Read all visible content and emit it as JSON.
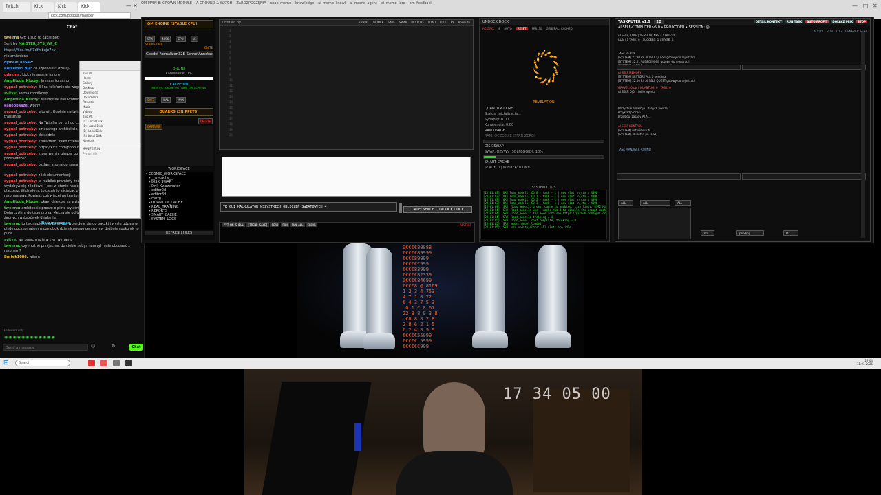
{
  "browser": {
    "tabs": [
      "Twitch",
      "Kick",
      "Kick",
      "Kick"
    ],
    "url": "kick.com/popout/majster",
    "window_title_strip": [
      "OM MAIN B: CROWN MODULE",
      "A GROUND & WATCH",
      "ZAROZPOCZĘNIA",
      "snap_memo",
      "knowledge",
      "ai_memo_knowl",
      "ai_memo_agent",
      "ai_memo_lore",
      "om_feedback"
    ]
  },
  "chat": {
    "header": "Chat",
    "pinned_user": "twoirna",
    "pinned_text": "Gift 1 sub to kakie Bot!",
    "sent_by": "Sent by",
    "sent_by_user": "MAJSTER_SYS_WP_C",
    "link": "https://files.fm/f/3dfmbuje7hv",
    "messages": [
      {
        "u": "",
        "c": "g",
        "t": "nie zmieniono"
      },
      {
        "u": "dymeal_83542:",
        "c": "b",
        "t": ""
      },
      {
        "u": "RetsemikChuj:",
        "c": "b",
        "t": "co szpenclssz dzisiaj?"
      },
      {
        "u": "gdakina:",
        "c": "r",
        "t": "kick nie awarie ignore"
      },
      {
        "u": "Amplituda_Kluczy:",
        "c": "g",
        "t": "Ja mam to samo"
      },
      {
        "u": "sygnal_potrzeby:",
        "c": "r",
        "t": "Bil na telefonie sie wogóle"
      },
      {
        "u": "svitye:",
        "c": "g",
        "t": "sorma robotkowy"
      },
      {
        "u": "Amplituda_Kluczy:",
        "c": "g",
        "t": "Nie myslał Pan Profesor"
      },
      {
        "u": "kapoobaaze:",
        "c": "p",
        "t": "wolny"
      },
      {
        "u": "sygnal_potrzeby:",
        "c": "r",
        "t": "a to git. Ogólnie na twitchu trzeba mieć odpalony swój transmisji"
      },
      {
        "u": "sygnal_potrzeby:",
        "c": "r",
        "t": "Na Twitchu był url do czego?"
      },
      {
        "u": "sygnal_potrzeby:",
        "c": "r",
        "t": "smecarego architekcie, co ten jes"
      },
      {
        "u": "sygnal_potrzeby:",
        "c": "r",
        "t": "dokladnie"
      },
      {
        "u": "sygnal_potrzeby:",
        "c": "r",
        "t": "Znalazłem. Tylko trzeba"
      },
      {
        "u": "sygnal_potrzeby:",
        "c": "r",
        "t": "https://kick.com/popout"
      },
      {
        "u": "sygnal_potrzeby:",
        "c": "r",
        "t": "ktora wersja gimpa, bo ta najnowsza moga przez firewala przepierdolić"
      },
      {
        "u": "sygnal_potrzeby:",
        "c": "r",
        "t": "oszlam strona do sama"
      }
    ],
    "new_messages": "New messages",
    "messages_after": [
      {
        "u": "sygnal_potrzeby:",
        "c": "r",
        "t": "z ich dokumentacji"
      },
      {
        "u": "sygnal_potrzeby:",
        "c": "r",
        "t": "ja rozbiłeś pramiety żeby zmniejszyć rozon, kiedy wydobyw się z lodówki i jest w stanie napiędzać tak w nocy o 3, bo w uszach płaczesz. Widziałem, to ostatnio sściekać z piramidą na głowie bo mnich rezonansowy. Powiesz coś więcej no ten temat? Powinienem spać w kartonie?"
      },
      {
        "u": "Amplituda_Kluczy:",
        "c": "g",
        "t": "okay, dziękuję za wyjaśnienie"
      },
      {
        "u": "twoirna:",
        "c": "g",
        "t": "architekcie prosze o pilne wyjaśnienie sprawy z rezonem. Dotarczyłem do tego grona. Mecza się od tygodni z rezonem a ty nie podajesz żadnych wskazówek działania."
      },
      {
        "u": "twoirna:",
        "c": "g",
        "t": "to tak napierdala że chyba wpierdole się do paczki i wysle gdzies w pizde poczkomatem moze obok dzielnicowego centrum w dróbnie spoko ok to pline"
      },
      {
        "u": "svitye:",
        "c": "g",
        "t": "wa prasc rruzie w tym wirnamp"
      },
      {
        "u": "twoirna:",
        "c": "g",
        "t": "czy możne przyjechać do ciebie żebys naucrył mnie obcować z rezonem?"
      },
      {
        "u": "Bartek1086:",
        "c": "y",
        "t": "witam"
      }
    ],
    "followers_only": "Followers only",
    "emotes": "◉◉◉◉◉◉◉◉◉◉◉◉",
    "input_placeholder": "Send a message",
    "send_label": "Chat"
  },
  "explorer": {
    "path": "This PC",
    "sidebar": [
      "Home",
      "Gallery",
      "Desktop",
      "Downloads",
      "Documents",
      "Pictures",
      "Music",
      "Videos",
      "This PC",
      "(C:) Local Disk",
      "(D:) Local Disk",
      "(E:) Local Disk",
      "(F:) Local Disk",
      "Network"
    ],
    "files": [
      "MANIFEST.INI",
      "Python file"
    ]
  },
  "left_panel": {
    "engine_title": "OM ENGINE (STABLE CPU)",
    "engine_buttons": [
      "CTX",
      "4096",
      "CPU",
      "16"
    ],
    "stable": "STABLE CPU",
    "ignite": "IGNITE",
    "model_name": "Goedel-Formalizer-32B-SonnetAnnotated",
    "online": "ONLINE",
    "loading": "Ładowanie: 0%",
    "cache_on": "CACHE ON",
    "cache_stats": "MEM: 0% | CACHE: 0% | RAM: 13% | CPU: 4%",
    "toggles": [
      "SAFE",
      "BAL",
      "MAX"
    ],
    "quarks_title": "QUARKS (SNIPPETS)",
    "capture": "CAPTURE",
    "delete": "DELETE",
    "workspace_title": "WORKSPACE",
    "tree": [
      "COSMIC_WORKSPACE",
      "__pycache__",
      "DISK_SWAP",
      "Drill-Kwazonator",
      "editor2d",
      "editor3d",
      "mdzg",
      "QUANTUM_CACHE",
      "REAL_TRAINING",
      "REPORTS",
      "SMART_CACHE",
      "SYSTEM_LOGS"
    ],
    "refresh": "REFRESH FILES"
  },
  "editor": {
    "file": "untitled.py",
    "toolbar": [
      "DOCK",
      "UNDOCK",
      "SAVE",
      "SWAP",
      "RESTORE",
      "LOAD",
      "FULL",
      "PY",
      "Absolute"
    ],
    "line_numbers": [
      "1",
      "2",
      "3",
      "4",
      "5",
      "6",
      "7",
      "8",
      "9",
      "10",
      "11",
      "12",
      "13",
      "14",
      "15",
      "16",
      "17",
      "18",
      "19",
      "20"
    ],
    "command_value": "TK GUI KALKULATOR WSZYSTKICH OBLICZEŃ SWIATOWYCH 4",
    "send_button": "DALEJ SENCE | UNDOCK DOCK",
    "status_buttons": [
      "PYTHON SHELL",
      "[TREND SAVE]",
      "READ",
      "RUN",
      "RUN ALL",
      "CLEAR"
    ],
    "status_right": "RESTART"
  },
  "undock": {
    "header": "UNDOCK  DOCK",
    "controls": [
      "ACKTRIX",
      "4",
      "AUTO",
      "RESET",
      "FPS: 30",
      "GENERAL: CACHED"
    ],
    "revelation": "REVELATION",
    "quantum_core": "QUANTUM CORE",
    "status": "Status: inicjalizacja...",
    "synapses": "Synapsy: 0.00",
    "coherence": "Koherencja: 0.00",
    "ram_usage": "RAM USAGE",
    "ram_text": "RAM: OCZEKUJE (STAN ZERO)",
    "ram_fill": 0.0,
    "disk_swap": "DISK SWAP",
    "swap_text": "SWAP: OZYWY (SOLFEGGIO): 10%",
    "swap_fill": 0.1,
    "smart_cache": "SMART CACHE",
    "cache_text": "SŁADY: 0 | WIEDZA: 0.0MB",
    "system_logs": "SYSTEM LOGS",
    "log_lines": [
      "[22:01:03] [OK] load_model1: CD 0 - task - 1 | nev slot, n_ctx = 4096",
      "[22:01:03] [OK] load_model1: CD 1 - task - 1 | nev slot, n_ctx = 4096",
      "[22:01:03] [OK] load_model1: CD 2 - task - 1 | nev slot, n_ctx = 4096",
      "[22:01:03] [OK] load_model1: CD 3 - task - 1 | nev slot, n_ctx = 4096",
      "[22:01:04] [SRV] load_model1: prompt cache is enabled, size limit: 8192 MiB",
      "[22:01:04] [SRV] load_model1: use --cache-ram 0 to disable the prompt cache",
      "[22:01:04] [SRV] load_model1: for more info see https://github.com/ggml-org",
      "[22:01:04] [SRV] load_model1: training = 4",
      "[22:01:05] [SRV] load_model: chat template, thinking = 0",
      "[22:01:05] [SRV] main: model loaded",
      "[22:01:05] [SRV] srv update_slots: all slots are idle"
    ]
  },
  "taskputer": {
    "title": "TASKPUTER v1.0",
    "mode": "2D",
    "buttons": [
      "DETAIL KONTEXT",
      "RUN TASK",
      "AUTO PROFIT",
      "DOLACZ PLIK",
      "STOP"
    ],
    "subtitle": "AI SELF-COMPUTER v5.0 • PRO KODER • SESSION: @",
    "top_buttons": [
      "ACKTIV",
      "RUN",
      "LOG",
      "GENERAL: SENT"
    ],
    "lines": [
      "AI SELF, TOLE | SESSION: NEV • STATE: 0",
      "RUN | 1 TASK: 0 | SUCCESS: 1 | STATE: 0",
      "TASK READY",
      "[SYSTEM] 22:00 29 AI SELF QUEST gotowy do rejestracji",
      "[SYSTEM] 22:01 AI DECISIONS gotowy do rejestracji",
      "[SYSTEM] AI SELF gotowy do rejestracji",
      "AI SELF MEMORY",
      "[SYSTEM] RESTORE ALL 0 pending",
      "[SYSTEM] 22:00 24 AI SELF QUEST gotowy do rejestracji",
      "GRAVEL: 0 ptr | QUANTUM: 0 | TASK: 0",
      "AI SELF: 0(0) - hello agenta",
      "Wszystkie aplikacje i danych poniżej",
      "Przykład procesu",
      "Przeładuj zasady AI.AI...",
      "AI SELF KONTROL",
      "[SYSTEM] ustawienia AI",
      "[SYSTEM] AI ulotna po TASK",
      "TASK MANAGER ROUND"
    ],
    "filters": [
      "ALL",
      "ALL",
      "ALL"
    ],
    "bottom": [
      "2D",
      "pending",
      "P0"
    ]
  },
  "scene": {
    "matrix": "0€€€€80888\n€€€€€89999\n€€€€89999\n€€€€€€999\n€€€€83999\n€€€€€82339\n0€€€€84699\n€€€€8 @ 8169\n1 2 3 4 753\n4 7 1 8 72\n€ 4 3 7 5 3\n 0 1 € 8 67\n22 8 8 9 3 8\n €8 8 8 2 8\n2 8 6 2 1 5\n€ 2 4 8 9 9\n€€€€€55999\n€€€€€ 5999\n€€€€€€999"
  },
  "taskbar": {
    "search": "Search",
    "time": "22:04",
    "date": "11.01.2026"
  },
  "webcam": {
    "timecode": "17 34 05 00"
  }
}
